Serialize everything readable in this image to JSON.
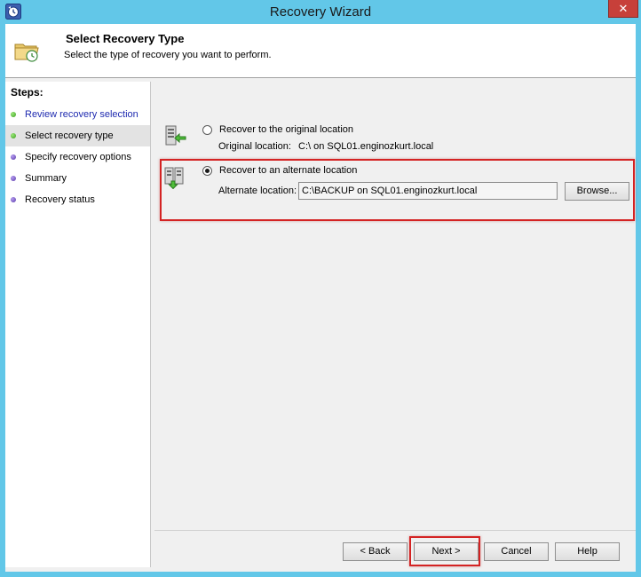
{
  "window": {
    "title": "Recovery Wizard",
    "close_glyph": "✕",
    "icon": "backup-clock-icon"
  },
  "header": {
    "title": "Select Recovery Type",
    "subtitle": "Select the type of recovery you want to perform.",
    "icon": "folder-recovery-icon"
  },
  "steps": {
    "title": "Steps:",
    "items": [
      {
        "label": "Review recovery selection",
        "state": "done"
      },
      {
        "label": "Select recovery type",
        "state": "current"
      },
      {
        "label": "Specify recovery options",
        "state": "pending"
      },
      {
        "label": "Summary",
        "state": "pending"
      },
      {
        "label": "Recovery status",
        "state": "pending"
      }
    ]
  },
  "options": {
    "original": {
      "label": "Recover to the original location",
      "location_label": "Original location:",
      "location_value": "C:\\ on SQL01.enginozkurt.local",
      "selected": false,
      "icon": "server-arrow-left-icon"
    },
    "alternate": {
      "label": "Recover to an alternate location",
      "location_label": "Alternate location:",
      "location_value": "C:\\BACKUP on SQL01.enginozkurt.local",
      "selected": true,
      "browse_label": "Browse...",
      "icon": "servers-arrow-down-icon"
    }
  },
  "footer": {
    "back_label": "< Back",
    "next_label": "Next >",
    "cancel_label": "Cancel",
    "help_label": "Help"
  },
  "colors": {
    "window_frame": "#62c7e8",
    "close_button": "#c7403a",
    "highlight": "#d42323",
    "step_done_text": "#1f2bb0",
    "step_done_dot": "#3a9e1e",
    "step_pending_dot": "#5a3aa8"
  }
}
